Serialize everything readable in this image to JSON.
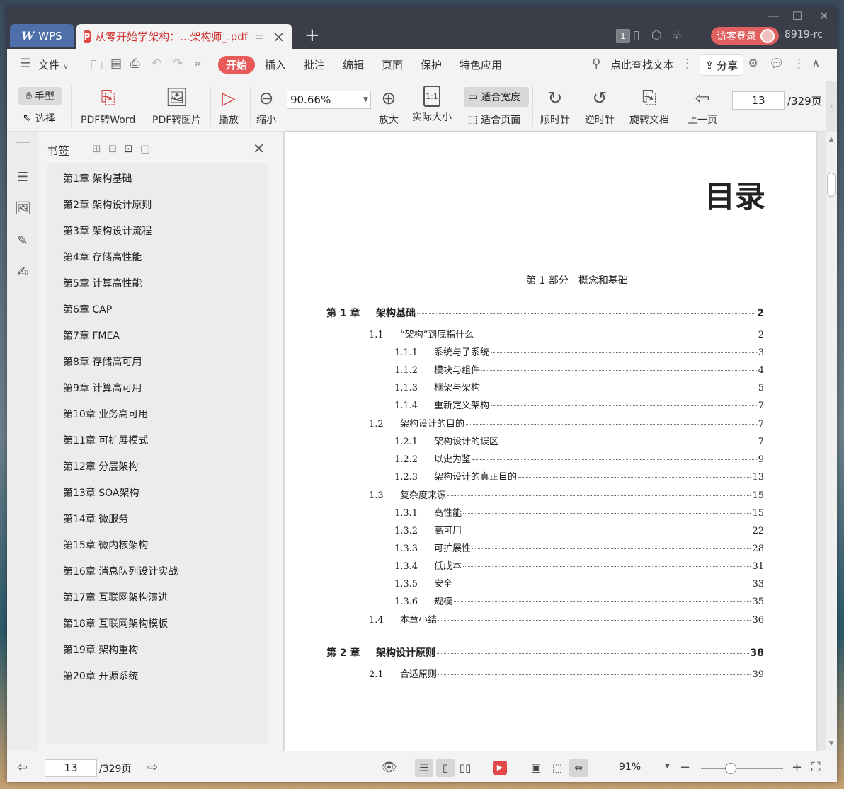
{
  "titlebar": {
    "app_tab": "WPS",
    "doc_tab_title": "从零开始学架构：...架构师_.pdf",
    "notification_count": "1",
    "login_label": "访客登录",
    "user_id": "8919-rc"
  },
  "menubar": {
    "file": "文件",
    "tabs": [
      "开始",
      "插入",
      "批注",
      "编辑",
      "页面",
      "保护",
      "特色应用"
    ],
    "search": "点此查找文本",
    "share": "分享"
  },
  "toolbar": {
    "hand": "手型",
    "select": "选择",
    "pdf_to_word": "PDF转Word",
    "pdf_to_image": "PDF转图片",
    "play": "播放",
    "zoom_out": "缩小",
    "zoom_value": "90.66%",
    "zoom_in": "放大",
    "actual_size": "实际大小",
    "actual_size_icon": "1:1",
    "fit_width": "适合宽度",
    "fit_page": "适合页面",
    "rotate_cw": "顺时针",
    "rotate_ccw": "逆时针",
    "rotate_doc": "旋转文档",
    "prev_page": "上一页",
    "current_page": "13",
    "total_pages": "/329页"
  },
  "bookmarks": {
    "title": "书签",
    "items": [
      "第1章 架构基础",
      "第2章 架构设计原则",
      "第3章 架构设计流程",
      "第4章 存储高性能",
      "第5章 计算高性能",
      "第6章 CAP",
      "第7章 FMEA",
      "第8章 存储高可用",
      "第9章 计算高可用",
      "第10章 业务高可用",
      "第11章 可扩展模式",
      "第12章 分层架构",
      "第13章 SOA架构",
      "第14章 微服务",
      "第15章 微内核架构",
      "第16章 消息队列设计实战",
      "第17章 互联网架构演进",
      "第18章 互联网架构模板",
      "第19章 架构重构",
      "第20章 开源系统"
    ]
  },
  "document": {
    "toc_title": "目录",
    "part_title": "第 1 部分　概念和基础",
    "entries": [
      {
        "level": 1,
        "num": "第 1 章",
        "text": "架构基础",
        "page": "2"
      },
      {
        "level": 2,
        "num": "1.1",
        "text": "“架构”到底指什么",
        "page": "2"
      },
      {
        "level": 3,
        "num": "1.1.1",
        "text": "系统与子系统",
        "page": "3"
      },
      {
        "level": 3,
        "num": "1.1.2",
        "text": "模块与组件",
        "page": "4"
      },
      {
        "level": 3,
        "num": "1.1.3",
        "text": "框架与架构",
        "page": "5"
      },
      {
        "level": 3,
        "num": "1.1.4",
        "text": "重新定义架构",
        "page": "7"
      },
      {
        "level": 2,
        "num": "1.2",
        "text": "架构设计的目的",
        "page": "7"
      },
      {
        "level": 3,
        "num": "1.2.1",
        "text": "架构设计的误区",
        "page": "7"
      },
      {
        "level": 3,
        "num": "1.2.2",
        "text": "以史为鉴",
        "page": "9"
      },
      {
        "level": 3,
        "num": "1.2.3",
        "text": "架构设计的真正目的",
        "page": "13"
      },
      {
        "level": 2,
        "num": "1.3",
        "text": "复杂度来源",
        "page": "15"
      },
      {
        "level": 3,
        "num": "1.3.1",
        "text": "高性能",
        "page": "15"
      },
      {
        "level": 3,
        "num": "1.3.2",
        "text": "高可用",
        "page": "22"
      },
      {
        "level": 3,
        "num": "1.3.3",
        "text": "可扩展性",
        "page": "28"
      },
      {
        "level": 3,
        "num": "1.3.4",
        "text": "低成本",
        "page": "31"
      },
      {
        "level": 3,
        "num": "1.3.5",
        "text": "安全",
        "page": "33"
      },
      {
        "level": 3,
        "num": "1.3.6",
        "text": "规模",
        "page": "35"
      },
      {
        "level": 2,
        "num": "1.4",
        "text": "本章小结",
        "page": "36"
      },
      {
        "level": 1,
        "num": "第 2 章",
        "text": "架构设计原则",
        "page": "38"
      },
      {
        "level": 2,
        "num": "2.1",
        "text": "合适原则",
        "page": "39"
      }
    ]
  },
  "statusbar": {
    "current_page": "13",
    "total_pages": "/329页",
    "zoom": "91%",
    "zoom_fraction": 0.36
  },
  "colors": {
    "accent": "#e85a5a",
    "titlebar": "#3b3e48",
    "wps_tab": "#4d6faa"
  }
}
